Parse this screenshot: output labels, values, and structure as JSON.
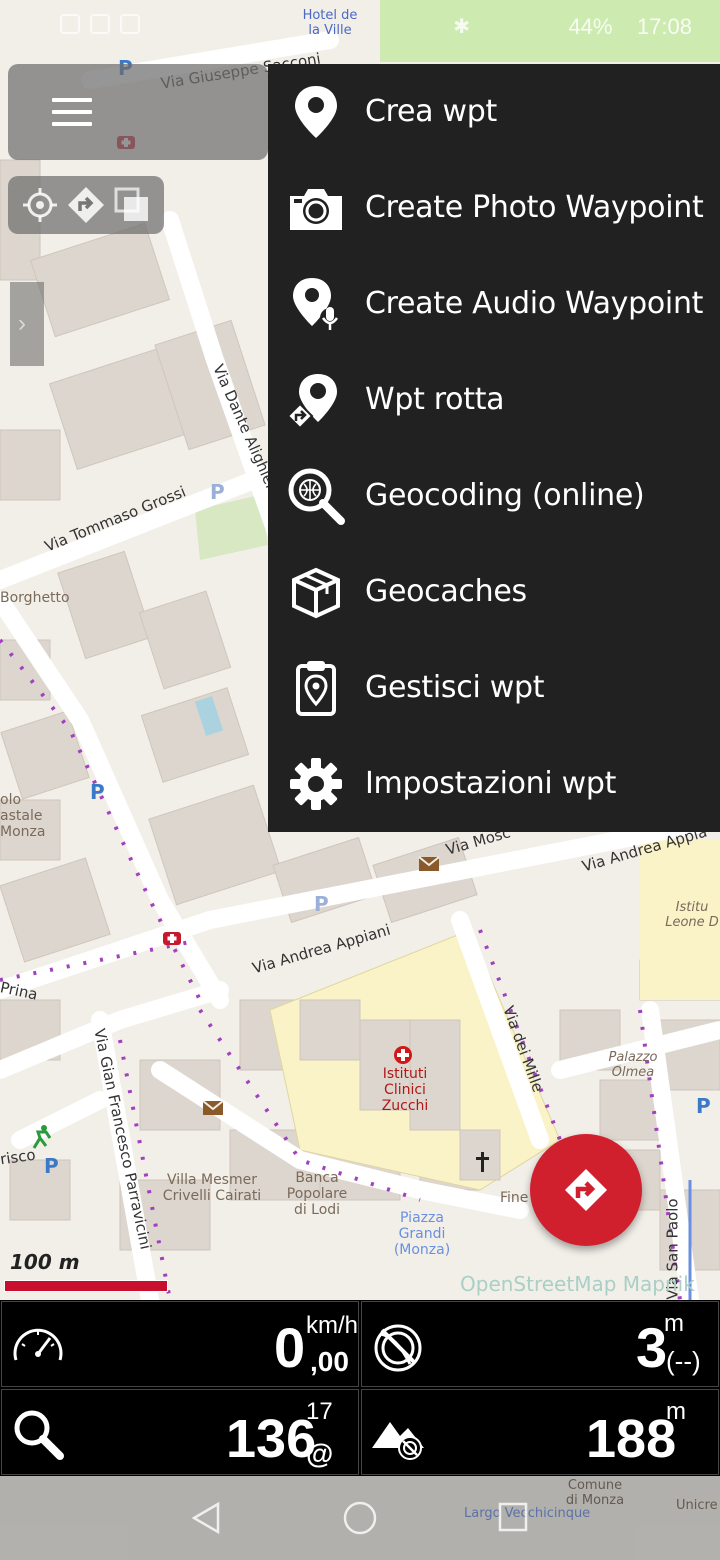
{
  "status_bar": {
    "battery": "44%",
    "time": "17:08"
  },
  "wpt_menu": {
    "items": [
      {
        "label": "Crea wpt",
        "icon": "pin-icon"
      },
      {
        "label": "Create Photo Waypoint",
        "icon": "camera-icon"
      },
      {
        "label": "Create Audio Waypoint",
        "icon": "mic-pin-icon"
      },
      {
        "label": "Wpt rotta",
        "icon": "route-pin-icon"
      },
      {
        "label": "Geocoding (online)",
        "icon": "globe-search-icon"
      },
      {
        "label": "Geocaches",
        "icon": "box-icon"
      },
      {
        "label": "Gestisci wpt",
        "icon": "clipboard-pin-icon"
      },
      {
        "label": "Impostazioni wpt",
        "icon": "gear-icon"
      }
    ]
  },
  "map": {
    "scale": "100 m",
    "attribution": "OpenStreetMap Mapnik",
    "streets": {
      "sacconi": "Via Giuseppe Sacconi",
      "dante": "Via Dante Alighieri",
      "grossi": "Via Tommaso Grossi",
      "appiani": "Via Andrea Appiani",
      "appiani_right": "Via Andrea Appia",
      "mosc": "Via Mosc",
      "mille": "Via dei Mille",
      "parravicini": "Via Gian Francesco Parravicini",
      "sanpaolo": "Via San Paolo",
      "prina": "Prina",
      "risco": "risco"
    },
    "pois": {
      "hotel": "Hotel de la Ville",
      "borghetto": "Borghetto",
      "istituti": "Istituti Clinici Zucchi",
      "villa": "Villa Mesmer Crivelli Cairati",
      "banca": "Banca Popolare di Lodi",
      "piazza": "Piazza Grandi (Monza)",
      "palazzo": "Palazzo Olmea",
      "leone": "Istitu Leone D",
      "comune": "Comune di Monza",
      "largo": "Largo Vecchicinque",
      "unicre": "Unicre",
      "olo": "olo astale Monza",
      "fine": "Fine"
    }
  },
  "dashboard": {
    "speed": {
      "value": "0",
      "decimals": ",00",
      "unit": "km/h"
    },
    "accuracy": {
      "value": "3",
      "unit": "m",
      "extra": "(--)"
    },
    "satellites": {
      "value": "136",
      "sup": "17",
      "sub": "@"
    },
    "altitude": {
      "value": "188",
      "unit": "m"
    }
  },
  "colors": {
    "menu_bg": "#212121",
    "fab": "#d0202e",
    "scale_bar": "#c8102e",
    "dashboard_bg": "#000000"
  }
}
